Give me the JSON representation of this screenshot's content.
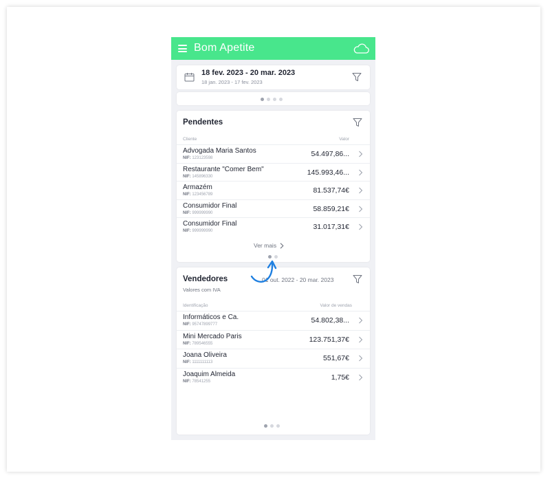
{
  "app": {
    "title": "Bom Apetite"
  },
  "date_filter": {
    "range": "18 fev. 2023 - 20 mar. 2023",
    "compare_range": "18 jan. 2023 - 17 fev. 2023"
  },
  "pendentes": {
    "title": "Pendentes",
    "col_client": "Cliente",
    "col_value": "Valor",
    "nif_label": "NIF:",
    "see_more": "Ver mais",
    "rows": [
      {
        "name": "Advogada Maria Santos",
        "nif": "123123598",
        "value": "54.497,86..."
      },
      {
        "name": "Restaurante \"Comer Bem\"",
        "nif": "145896330",
        "value": "145.993,46..."
      },
      {
        "name": "Armazém",
        "nif": "123456789",
        "value": "81.537,74€"
      },
      {
        "name": "Consumidor Final",
        "nif": "999999990",
        "value": "58.859,21€"
      },
      {
        "name": "Consumidor Final",
        "nif": "999999990",
        "value": "31.017,31€"
      }
    ]
  },
  "vendedores": {
    "title": "Vendedores",
    "range": "01 out. 2022 - 20 mar. 2023",
    "subtitle": "Valores com IVA",
    "col_id": "Identificação",
    "col_value": "Valor de vendas",
    "nif_label": "NIF:",
    "rows": [
      {
        "name": "Informáticos e Ca.",
        "nif": "95747899777",
        "value": "54.802,38..."
      },
      {
        "name": "Mini Mercado Paris",
        "nif": "789546555",
        "value": "123.751,37€"
      },
      {
        "name": "Joana Oliveira",
        "nif": "1111111113",
        "value": "551,67€"
      },
      {
        "name": "Joaquim Almeida",
        "nif": "78541255",
        "value": "1,75€"
      }
    ]
  },
  "colors": {
    "accent": "#48e68c",
    "swipe_arrow": "#1e7fe0"
  },
  "icons": [
    "menu-icon",
    "cloud-icon",
    "calendar-icon",
    "filter-icon",
    "chevron-right-icon",
    "swipe-arrow-icon"
  ]
}
